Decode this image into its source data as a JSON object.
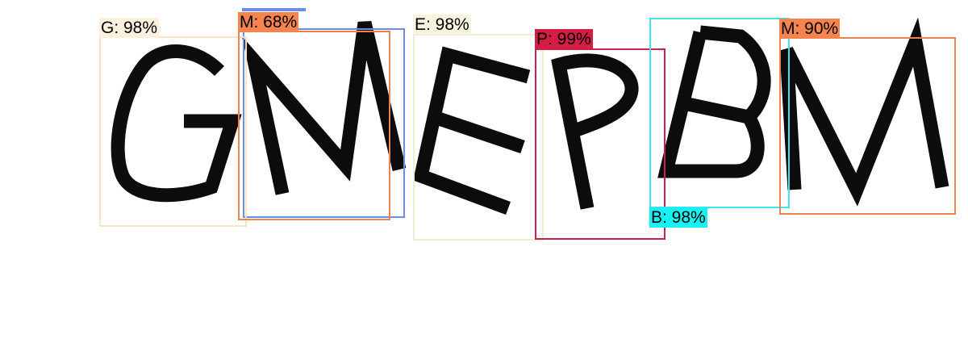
{
  "captcha": {
    "glyphs": [
      "G",
      "M",
      "E",
      "P",
      "B",
      "M"
    ]
  },
  "detections": [
    {
      "id": "g",
      "char": "G",
      "label": "G: 98%",
      "confidence": 98,
      "color": "#fbe3c6",
      "label_bg": "#fdf0dc"
    },
    {
      "id": "m1",
      "char": "M",
      "label": "M: 68%",
      "confidence": 68,
      "color": "#ee8350",
      "label_bg": "#f5844f"
    },
    {
      "id": "e",
      "char": "E",
      "label": "E: 98%",
      "confidence": 98,
      "color": "#eeeed8",
      "label_bg": "#f4f4df"
    },
    {
      "id": "p",
      "char": "P",
      "label": "P: 99%",
      "confidence": 99,
      "color": "#c2244b",
      "label_bg": "#d51c45"
    },
    {
      "id": "b",
      "char": "B",
      "label": "B: 98%",
      "confidence": 98,
      "color": "#3de4e8",
      "label_bg": "#17f1f3"
    },
    {
      "id": "m2",
      "char": "M",
      "label": "M: 90%",
      "confidence": 90,
      "color": "#ee8350",
      "label_bg": "#f5844f"
    }
  ],
  "extra_boxes": [
    {
      "id": "m1-alt",
      "color": "#6a8fe0"
    }
  ]
}
